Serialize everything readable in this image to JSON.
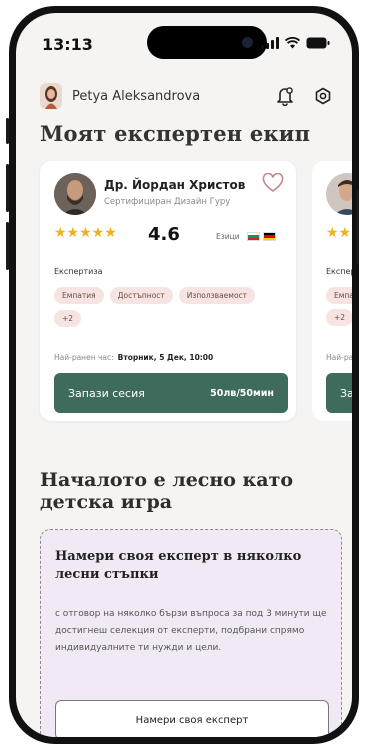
{
  "status": {
    "time": "13:13"
  },
  "header": {
    "user_name": "Petya Aleksandrova"
  },
  "section_team": {
    "title": "Моят експертен екип"
  },
  "expert_card": {
    "name": "Др. Йордан Христов",
    "title": "Сертифициран Дизайн Гуру",
    "rating": "4.6",
    "stars": "★★★★★",
    "languages_label": "Езици",
    "expertise_label": "Експертиза",
    "tags": [
      "Емпатия",
      "Достъпност",
      "Използваемост",
      "+2"
    ],
    "earliest_label": "Най-ранен час:",
    "earliest_value": "Вторник, 5 Дек, 10:00",
    "book_label": "Запази сесия",
    "book_price": "50лв/50мин"
  },
  "peek_card": {
    "stars": "★★★",
    "expertise_label": "Експер",
    "tag": "Емпа",
    "more_tag": "+2",
    "earliest_label": "Най-ра",
    "book_label": "Зап"
  },
  "section_start": {
    "title": "Началото е лесно като детска игра"
  },
  "howto": {
    "title": "Намери своя експерт в няколко лесни стъпки",
    "text": "с отговор на няколко бързи въпроса за под 3 минути ще достигнеш селекция от експерти, подбрани спрямо индивидуалните ти нужди и цели.",
    "button_label": "Намери своя експерт"
  },
  "colors": {
    "primary_green": "#3e6b5b",
    "tag_bg": "#f5e4e1",
    "howto_bg": "#f1eaf4",
    "star": "#f0b21c"
  },
  "icons": [
    "bell-icon",
    "settings-icon",
    "heart-icon",
    "signal-icon",
    "wifi-icon",
    "battery-icon"
  ]
}
